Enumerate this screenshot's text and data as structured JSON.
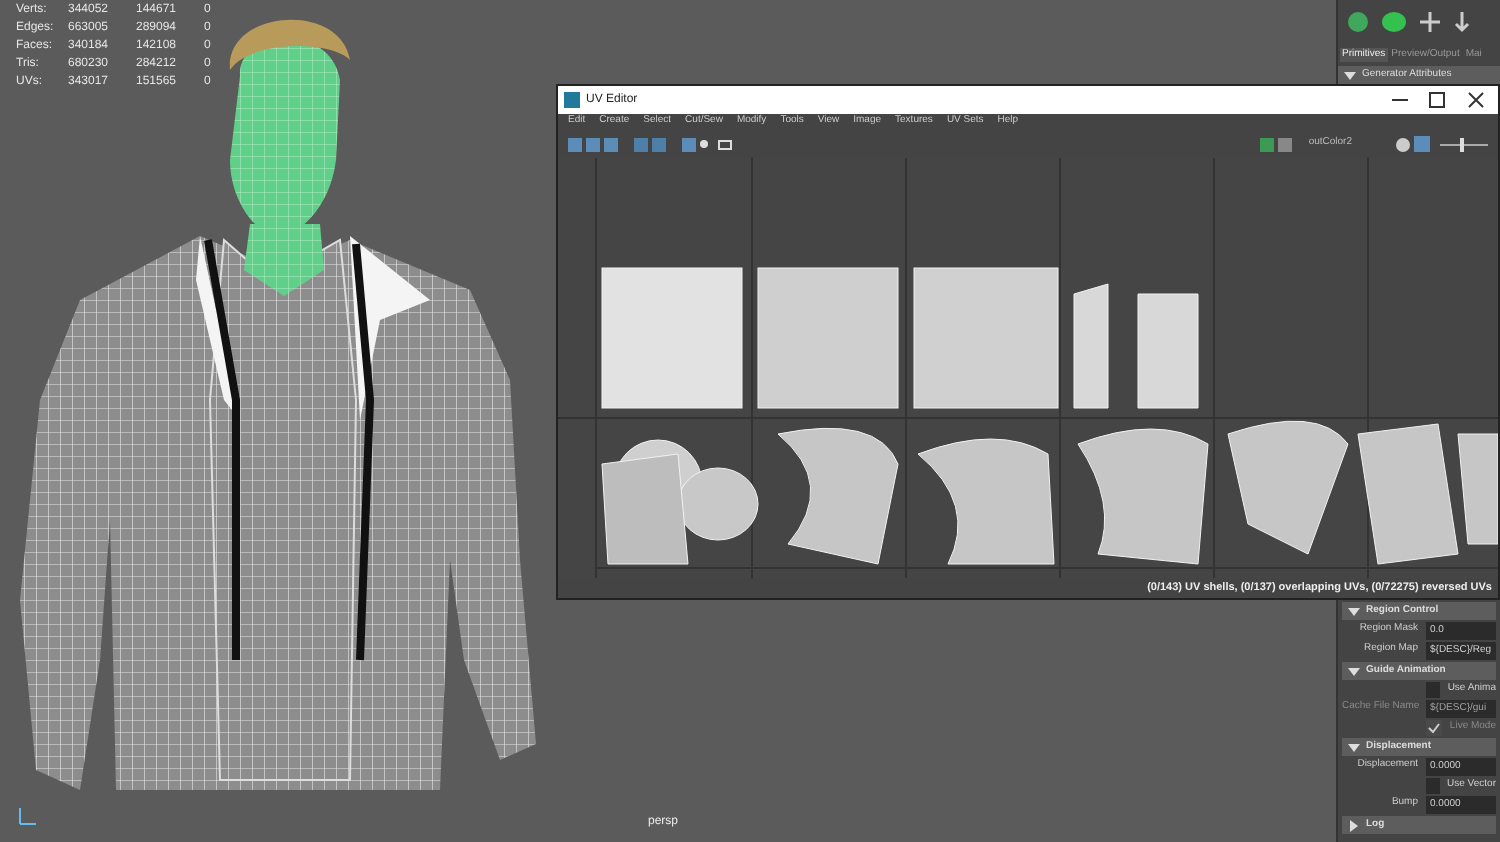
{
  "viewport": {
    "stats": [
      {
        "label": "Verts:",
        "values": [
          "344052",
          "144671",
          "0"
        ]
      },
      {
        "label": "Edges:",
        "values": [
          "663005",
          "289094",
          "0"
        ]
      },
      {
        "label": "Faces:",
        "values": [
          "340184",
          "142108",
          "0"
        ]
      },
      {
        "label": "Tris:",
        "values": [
          "680230",
          "284212",
          "0"
        ]
      },
      {
        "label": "UVs:",
        "values": [
          "343017",
          "151565",
          "0"
        ]
      }
    ],
    "camera": "persp"
  },
  "uv_editor": {
    "title": "UV Editor",
    "menu": [
      "Edit",
      "Create",
      "Select",
      "Cut/Sew",
      "Modify",
      "Tools",
      "View",
      "Image",
      "Textures",
      "UV Sets",
      "Help"
    ],
    "uv_set": "outColor2",
    "exposure": {
      "level": 0.45
    },
    "status": "(0/143) UV shells, (0/137) overlapping UVs, (0/72275) reversed UVs"
  },
  "attribute_editor": {
    "tabs": [
      {
        "label": "Primitives",
        "selected": true
      },
      {
        "label": "Preview/Output",
        "selected": false
      },
      {
        "label": "Mai",
        "selected": false
      }
    ],
    "header": {
      "title": "Generator Attributes",
      "expanded": true
    },
    "sections": [
      {
        "title": "Region Control",
        "expanded": true,
        "rows": [
          {
            "kind": "field",
            "label": "Region Mask",
            "value": "0.0",
            "disabled": false
          },
          {
            "kind": "field",
            "label": "Region Map",
            "value": "${DESC}/Reg",
            "disabled": false
          }
        ]
      },
      {
        "title": "Guide Animation",
        "expanded": true,
        "rows": [
          {
            "kind": "checkbox",
            "label": "Use Anima",
            "checked": false,
            "disabled": false
          },
          {
            "kind": "field",
            "label": "Cache File Name",
            "value": "${DESC}/gui",
            "disabled": true
          },
          {
            "kind": "checkbox",
            "label": "Live Mode",
            "checked": true,
            "disabled": true
          }
        ]
      },
      {
        "title": "Displacement",
        "expanded": true,
        "rows": [
          {
            "kind": "field",
            "label": "Displacement",
            "value": "0.0000",
            "disabled": false
          },
          {
            "kind": "checkbox",
            "label": "Use Vector",
            "checked": false,
            "disabled": false
          },
          {
            "kind": "field",
            "label": "Bump",
            "value": "0.0000",
            "disabled": false
          }
        ]
      },
      {
        "title": "Log",
        "expanded": false
      }
    ]
  }
}
